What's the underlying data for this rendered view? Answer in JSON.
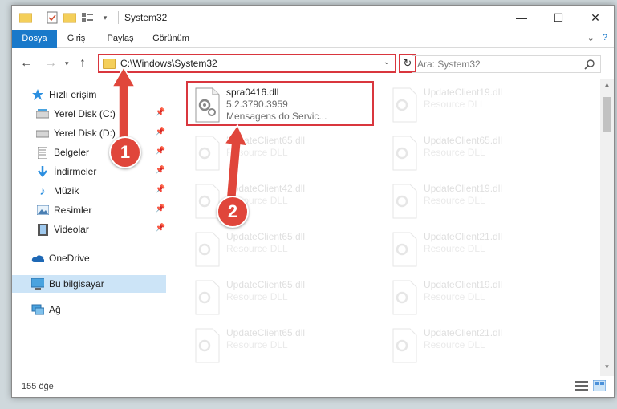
{
  "window": {
    "title": "System32",
    "controls": {
      "minimize": "—",
      "maximize": "☐",
      "close": "✕"
    }
  },
  "ribbon": {
    "tabs": [
      "Dosya",
      "Giriş",
      "Paylaş",
      "Görünüm"
    ]
  },
  "address": {
    "path": "C:\\Windows\\System32"
  },
  "search": {
    "placeholder": "Ara: System32"
  },
  "sidebar": {
    "items": [
      {
        "label": "Hızlı erişim",
        "icon": "star-icon"
      },
      {
        "label": "Yerel Disk (C:)",
        "icon": "drive-icon"
      },
      {
        "label": "Yerel Disk (D:)",
        "icon": "drive-icon"
      },
      {
        "label": "Belgeler",
        "icon": "documents-icon"
      },
      {
        "label": "İndirmeler",
        "icon": "download-icon"
      },
      {
        "label": "Müzik",
        "icon": "music-icon"
      },
      {
        "label": "Resimler",
        "icon": "pictures-icon"
      },
      {
        "label": "Videolar",
        "icon": "videos-icon"
      },
      {
        "label": "OneDrive",
        "icon": "cloud-icon"
      },
      {
        "label": "Bu bilgisayar",
        "icon": "computer-icon"
      },
      {
        "label": "Ağ",
        "icon": "network-icon"
      }
    ]
  },
  "files": {
    "selected": {
      "name": "spra0416.dll",
      "version": "5.2.3790.3959",
      "description": "Mensagens do Servic..."
    },
    "left": [
      {
        "name": "UpdateClient65.dll",
        "description": "Resource DLL"
      },
      {
        "name": "UpdateClient42.dll",
        "description": "Resource DLL"
      },
      {
        "name": "UpdateClient65.dll",
        "description": "Resource DLL"
      },
      {
        "name": "UpdateClient65.dll",
        "description": "Resource DLL"
      },
      {
        "name": "UpdateClient65.dll",
        "description": "Resource DLL"
      }
    ],
    "right": [
      {
        "name": "UpdateClient19.dll",
        "description": "Resource DLL"
      },
      {
        "name": "UpdateClient65.dll",
        "description": "Resource DLL"
      },
      {
        "name": "UpdateClient19.dll",
        "description": "Resource DLL"
      },
      {
        "name": "UpdateClient21.dll",
        "description": "Resource DLL"
      },
      {
        "name": "UpdateClient19.dll",
        "description": "Resource DLL"
      },
      {
        "name": "UpdateClient21.dll",
        "description": "Resource DLL"
      }
    ]
  },
  "status": {
    "item_count": "155 öğe"
  },
  "callouts": [
    "1",
    "2"
  ],
  "colors": {
    "accent": "#1979ca",
    "highlight": "#d9363e",
    "callout": "#e0463b",
    "selected_nav": "#cce4f7"
  }
}
